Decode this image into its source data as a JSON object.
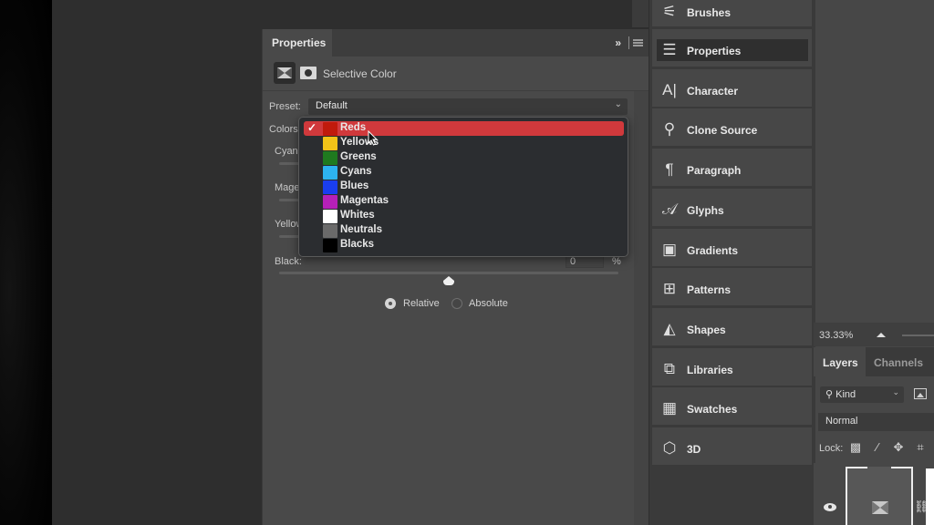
{
  "properties_panel": {
    "tab_label": "Properties",
    "collapse_label": "»",
    "adjustment_title": "Selective Color",
    "preset": {
      "label": "Preset:",
      "value": "Default"
    },
    "colors": {
      "label": "Colors",
      "selected": "Reds"
    },
    "sliders": [
      {
        "label": "Cyan",
        "value": ""
      },
      {
        "label": "Mage",
        "value": ""
      },
      {
        "label": "Yellow",
        "value": ""
      },
      {
        "label": "Black:",
        "value": "0",
        "unit": "%"
      }
    ],
    "method": {
      "options": [
        {
          "label": "Relative",
          "selected": true
        },
        {
          "label": "Absolute",
          "selected": false
        }
      ]
    }
  },
  "colors_dropdown": {
    "items": [
      {
        "label": "Reds",
        "swatch": "#c01a0c",
        "selected": true
      },
      {
        "label": "Yellows",
        "swatch": "#f2c418",
        "selected": false
      },
      {
        "label": "Greens",
        "swatch": "#1f7a1f",
        "selected": false
      },
      {
        "label": "Cyans",
        "swatch": "#2db3ef",
        "selected": false
      },
      {
        "label": "Blues",
        "swatch": "#1a3ef0",
        "selected": false
      },
      {
        "label": "Magentas",
        "swatch": "#b620b8",
        "selected": false
      },
      {
        "label": "Whites",
        "swatch": "#ffffff",
        "selected": false
      },
      {
        "label": "Neutrals",
        "swatch": "#6a6a6a",
        "selected": false
      },
      {
        "label": "Blacks",
        "swatch": "#000000",
        "selected": false
      }
    ],
    "checkmark": "✓"
  },
  "dock": {
    "items": [
      {
        "label": "Brushes",
        "icon": "brushes-icon",
        "glyph": "⚟",
        "active": false
      },
      {
        "label": "Properties",
        "icon": "properties-icon",
        "glyph": "☰",
        "active": true
      },
      {
        "label": "Character",
        "icon": "character-icon",
        "glyph": "A|",
        "active": false
      },
      {
        "label": "Clone Source",
        "icon": "clone-source-icon",
        "glyph": "⚲",
        "active": false
      },
      {
        "label": "Paragraph",
        "icon": "paragraph-icon",
        "glyph": "¶",
        "active": false
      },
      {
        "label": "Glyphs",
        "icon": "glyphs-icon",
        "glyph": "𝒜",
        "active": false
      },
      {
        "label": "Gradients",
        "icon": "gradients-icon",
        "glyph": "▣",
        "active": false
      },
      {
        "label": "Patterns",
        "icon": "patterns-icon",
        "glyph": "⊞",
        "active": false
      },
      {
        "label": "Shapes",
        "icon": "shapes-icon",
        "glyph": "◭",
        "active": false
      },
      {
        "label": "Libraries",
        "icon": "libraries-icon",
        "glyph": "⧉",
        "active": false
      },
      {
        "label": "Swatches",
        "icon": "swatches-icon",
        "glyph": "▦",
        "active": false
      },
      {
        "label": "3D",
        "icon": "cube-icon",
        "glyph": "⬡",
        "active": false
      }
    ]
  },
  "navigator": {
    "zoom": "33.33%"
  },
  "layers_panel": {
    "tabs": [
      {
        "label": "Layers",
        "active": true
      },
      {
        "label": "Channels",
        "active": false
      }
    ],
    "filter": {
      "value": "Kind"
    },
    "blend_mode": "Normal",
    "lock_label": "Lock:"
  }
}
